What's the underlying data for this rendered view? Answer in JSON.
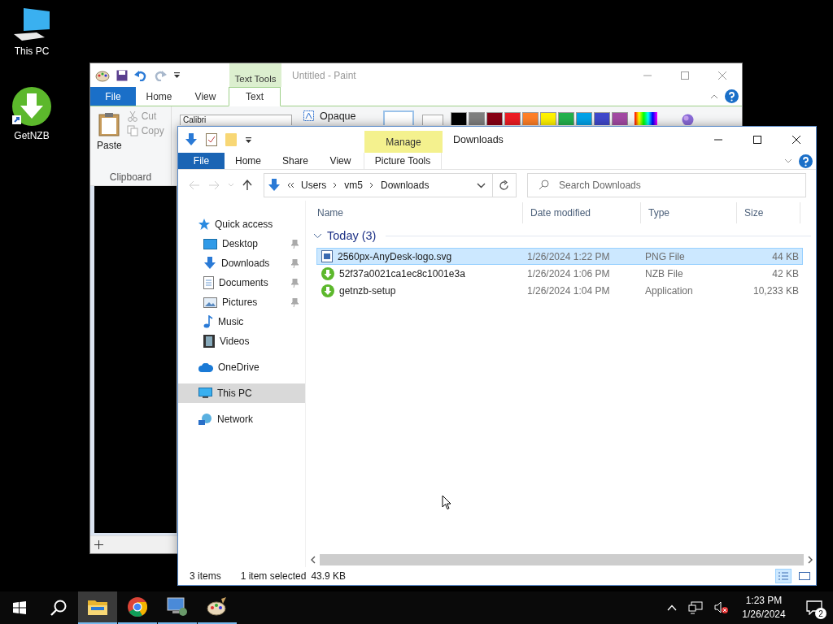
{
  "desktop_icons": [
    {
      "label": "This PC",
      "kind": "pc"
    },
    {
      "label": "GetNZB",
      "kind": "getnzb"
    }
  ],
  "paint": {
    "title": "Untitled - Paint",
    "context_tab": "Text Tools",
    "tabs": [
      {
        "label": "File",
        "kind": "file",
        "selected": false
      },
      {
        "label": "Home",
        "kind": "tab",
        "selected": false
      },
      {
        "label": "View",
        "kind": "tab",
        "selected": false
      },
      {
        "label": "Text",
        "kind": "tab",
        "selected": true
      }
    ],
    "paste": "Paste",
    "clipboard_items": [
      {
        "label": "Cut",
        "kind": "cut",
        "disabled": true
      },
      {
        "label": "Copy",
        "kind": "copy",
        "disabled": true
      }
    ],
    "group_label": "Clipboard",
    "font": "Calibri",
    "opaque": "Opaque",
    "swatches": [
      {
        "color": "#000000"
      },
      {
        "color": "#7f7f7f"
      },
      {
        "color": "#880015"
      },
      {
        "color": "#ed1c24"
      },
      {
        "color": "#ff7f27"
      },
      {
        "color": "#fff200"
      },
      {
        "color": "#22b14c"
      },
      {
        "color": "#00a2e8"
      },
      {
        "color": "#3f48cc"
      },
      {
        "color": "#a349a4"
      }
    ]
  },
  "explorer": {
    "title": "Downloads",
    "context_group": "Manage",
    "tabs": [
      {
        "label": "File",
        "kind": "file",
        "selected": false
      },
      {
        "label": "Home",
        "kind": "tab",
        "selected": false
      },
      {
        "label": "Share",
        "kind": "tab",
        "selected": false
      },
      {
        "label": "View",
        "kind": "tab",
        "selected": false
      },
      {
        "label": "Picture Tools",
        "kind": "context",
        "selected": false
      }
    ],
    "address": [
      "Users",
      "vm5",
      "Downloads"
    ],
    "search_placeholder": "Search Downloads",
    "sidebar": [
      {
        "label": "Quick access",
        "kind": "quick",
        "selected": false,
        "children": [
          {
            "label": "Desktop",
            "kind": "desktop",
            "pinned": true,
            "selected": false
          },
          {
            "label": "Downloads",
            "kind": "downloads",
            "pinned": true,
            "selected": false
          },
          {
            "label": "Documents",
            "kind": "documents",
            "pinned": true,
            "selected": false
          },
          {
            "label": "Pictures",
            "kind": "pictures",
            "pinned": true,
            "selected": false
          },
          {
            "label": "Music",
            "kind": "music",
            "pinned": false,
            "selected": false
          },
          {
            "label": "Videos",
            "kind": "videos",
            "pinned": false,
            "selected": false
          }
        ]
      },
      {
        "label": "OneDrive",
        "kind": "cloud",
        "selected": false
      },
      {
        "label": "This PC",
        "kind": "pc",
        "selected": true
      },
      {
        "label": "Network",
        "kind": "network",
        "selected": false
      }
    ],
    "columns": [
      "Name",
      "Date modified",
      "Type",
      "Size"
    ],
    "group": {
      "label": "Today (3)",
      "expanded": true
    },
    "files": [
      {
        "name": "2560px-AnyDesk-logo.svg",
        "date": "1/26/2024 1:22 PM",
        "type": "PNG File",
        "size": "44 KB",
        "kind": "image",
        "selected": true
      },
      {
        "name": "52f37a0021ca1ec8c1001e3a",
        "date": "1/26/2024 1:06 PM",
        "type": "NZB File",
        "size": "42 KB",
        "kind": "getnzb",
        "selected": false
      },
      {
        "name": "getnzb-setup",
        "date": "1/26/2024 1:04 PM",
        "type": "Application",
        "size": "10,233 KB",
        "kind": "getnzb",
        "selected": false
      }
    ],
    "status": {
      "count": "3 items",
      "selection": "1 item selected",
      "size": "43.9 KB"
    }
  },
  "taskbar": {
    "apps": [
      {
        "kind": "explorer",
        "active": true
      },
      {
        "kind": "chrome",
        "active": false
      },
      {
        "kind": "network",
        "active": false
      },
      {
        "kind": "paint",
        "active": false
      }
    ],
    "time": "1:23 PM",
    "date": "1/26/2024",
    "notifications": "2"
  }
}
